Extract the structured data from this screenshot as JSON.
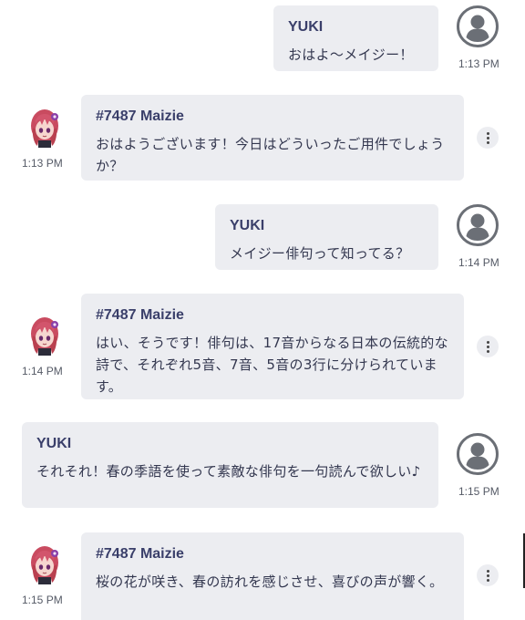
{
  "messages": [
    {
      "sender": "YUKI",
      "text": "おはよ〜メイジー！",
      "time": "1:13 PM"
    },
    {
      "sender": "#7487 Maizie",
      "text": "おはようございます！今日はどういったご用件でしょうか？",
      "time": "1:13 PM"
    },
    {
      "sender": "YUKI",
      "text": "メイジー俳句って知ってる？",
      "time": "1:14 PM"
    },
    {
      "sender": "#7487 Maizie",
      "text": "はい、そうです！俳句は、17音からなる日本の伝統的な詩で、それぞれ5音、7音、5音の3行に分けられています。",
      "time": "1:14 PM"
    },
    {
      "sender": "YUKI",
      "text": "それそれ！春の季語を使って素敵な俳句を一句読んで欲しい♪",
      "time": "1:15 PM"
    },
    {
      "sender": "#7487 Maizie",
      "text": "桜の花が咲き、春の訪れを感じさせ、喜びの声が響く。",
      "time": "1:15 PM"
    }
  ],
  "icons": {
    "user_avatar": "user-circle-icon",
    "bot_avatar": "anime-girl-avatar",
    "menu": "kebab-menu-icon"
  },
  "colors": {
    "bubble_bg": "#ecedf1",
    "name_text": "#3a3f6a",
    "body_text": "#33374f",
    "avatar_gray": "#6b6f76",
    "hair": "#d2556c"
  }
}
